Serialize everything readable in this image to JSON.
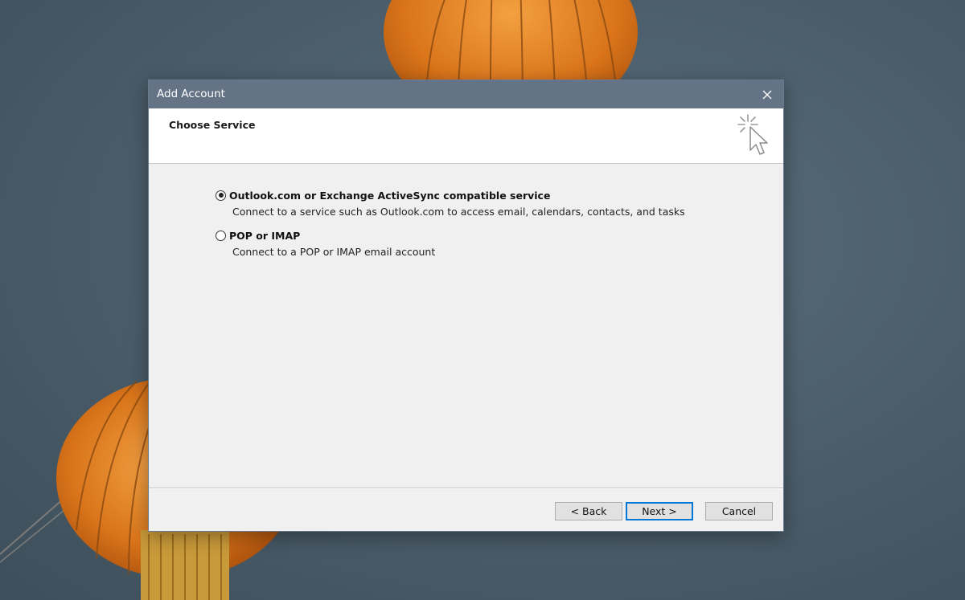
{
  "window": {
    "title": "Add Account"
  },
  "header": {
    "heading": "Choose Service"
  },
  "options": [
    {
      "label": "Outlook.com or Exchange ActiveSync compatible service",
      "description": "Connect to a service such as Outlook.com to access email, calendars, contacts, and tasks",
      "selected": true
    },
    {
      "label": "POP or IMAP",
      "description": "Connect to a POP or IMAP email account",
      "selected": false
    }
  ],
  "buttons": {
    "back": "< Back",
    "next": "Next >",
    "cancel": "Cancel"
  },
  "icons": {
    "close": "close-icon",
    "header_graphic": "cursor-click-icon"
  },
  "colors": {
    "titlebar": "#657387",
    "dialog_bg": "#f0f0f0",
    "header_bg": "#ffffff",
    "default_button_border": "#0078d7",
    "lantern": "#e07f22"
  }
}
